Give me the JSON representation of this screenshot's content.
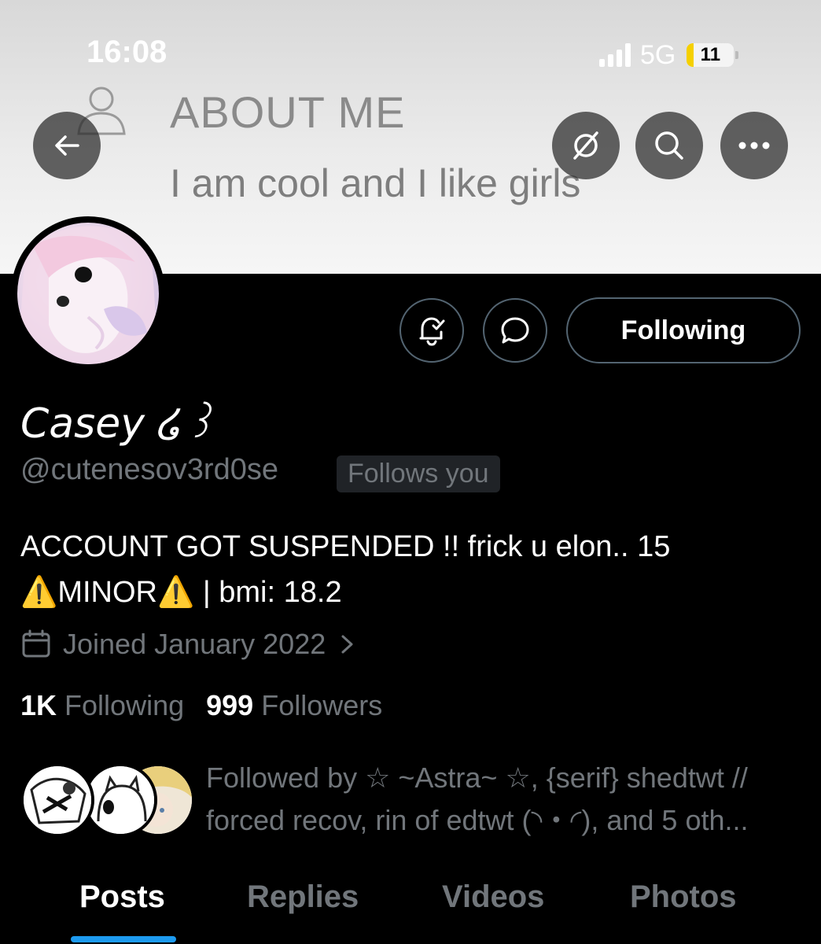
{
  "status_bar": {
    "time": "16:08",
    "network": "5G",
    "battery": "11"
  },
  "banner": {
    "heading": "ABOUT ME",
    "text": "I am cool and I like girls"
  },
  "header_icons": {
    "back": "arrow-left-icon",
    "grok": "grok-icon",
    "search": "search-icon",
    "more": "more-icon"
  },
  "profile": {
    "name": "Casey ໒꒱",
    "handle": "@cutenesov3rd0se",
    "follows_you": "Follows you",
    "bio_line1": "ACCOUNT GOT SUSPENDED !! frick u elon.. 15",
    "bio_line2": "⚠️MINOR⚠️ | bmi: 18.2",
    "joined": "Joined January 2022",
    "following_count": "1K",
    "following_label": "Following",
    "followers_count": "999",
    "followers_label": "Followers",
    "followed_by": "Followed by ☆ ~Astra~ ☆, {serif} shedtwt // forced recov, rin of edtwt (◝・◜), and 5 oth..."
  },
  "actions": {
    "following_button": "Following"
  },
  "tabs": [
    {
      "label": "Posts",
      "active": true
    },
    {
      "label": "Replies",
      "active": false
    },
    {
      "label": "Videos",
      "active": false
    },
    {
      "label": "Photos",
      "active": false
    }
  ],
  "colors": {
    "accent": "#1d9bf0",
    "muted": "#71767b",
    "background": "#000000"
  }
}
